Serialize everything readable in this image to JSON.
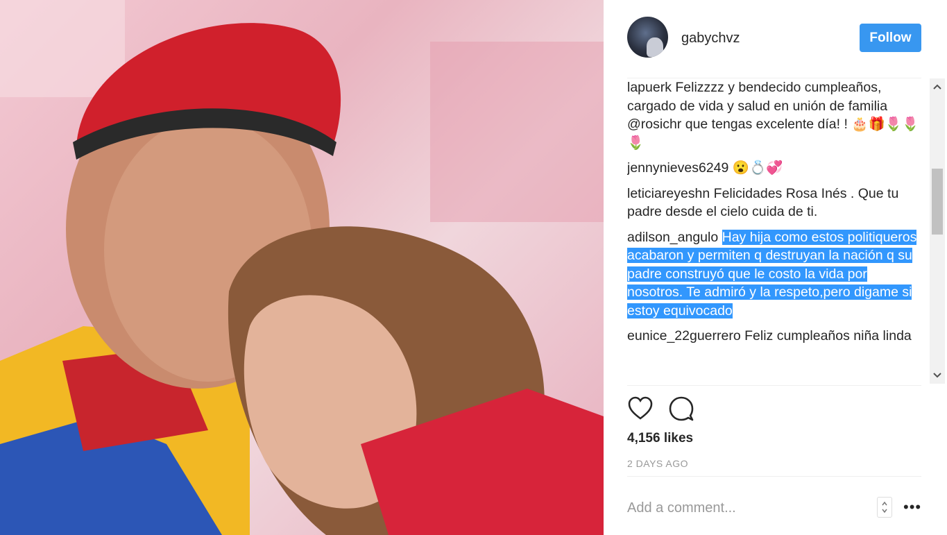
{
  "post": {
    "username": "gabychvz",
    "follow_label": "Follow",
    "likes": "4,156 likes",
    "time_ago": "2 DAYS AGO",
    "add_comment_placeholder": "Add a comment...",
    "more_label": "•••"
  },
  "comments": [
    {
      "user": "lapuerk",
      "text": "Felizzzz y bendecido cumpleaños, cargado de vida y salud en unión de familia @rosichr que tengas excelente día! ! 🎂🎁🌷🌷🌷"
    },
    {
      "user": "jennynieves6249",
      "text": "😮💍💞"
    },
    {
      "user": "leticiareyeshn",
      "text": "Felicidades Rosa Inés . Que tu padre desde el cielo cuida de ti."
    },
    {
      "user": "adilson_angulo",
      "text": "Hay hija como estos politiqueros acabaron y permiten q destruyan la nación q su padre construyó que le costo la vida por nosotros. Te admiró y la respeto,pero digame si estoy equivocado"
    },
    {
      "user": "eunice_22guerrero",
      "text": "Feliz cumpleaños niña linda"
    }
  ],
  "icons": {
    "like": "heart-icon",
    "comment": "speech-bubble-icon",
    "scroll_up": "chevron-up-icon",
    "scroll_down": "chevron-down-icon"
  },
  "colors": {
    "follow_button": "#3897f0",
    "highlight": "#3297fd",
    "beret": "#d0202c"
  }
}
